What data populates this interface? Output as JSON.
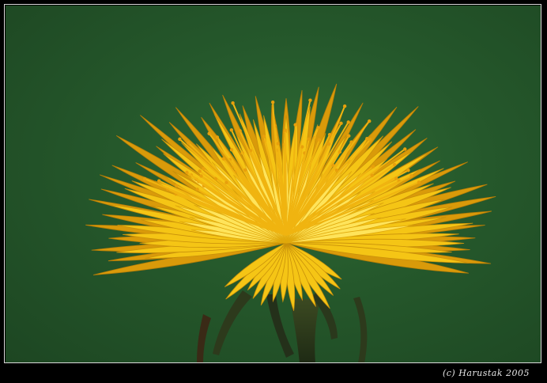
{
  "photo": {
    "subject_icon": "dandelion-flower",
    "background_color": "#25582b",
    "petal_color": "#f5c515",
    "petal_highlight": "#ffe45a",
    "petal_shadow": "#d99a0a",
    "stem_color": "#2a3b1e"
  },
  "caption": {
    "text": "(c)  Harustak 2005"
  }
}
